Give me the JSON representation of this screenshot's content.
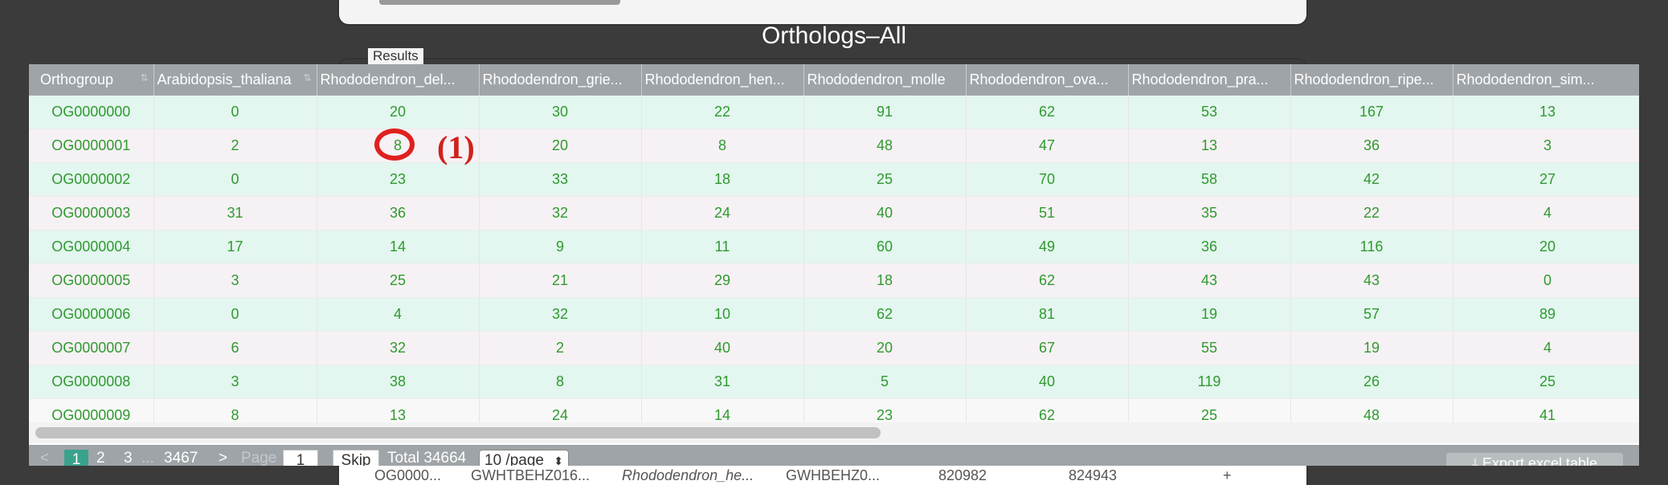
{
  "title": "Orthologs–All",
  "results_legend": "Results",
  "table": {
    "columns": [
      "Orthogroup",
      "Arabidopsis_thaliana",
      "Rhododendron_del...",
      "Rhododendron_grie...",
      "Rhododendron_hen...",
      "Rhododendron_molle",
      "Rhododendron_ova...",
      "Rhododendron_pra...",
      "Rhododendron_ripe...",
      "Rhododendron_sim..."
    ],
    "rows": [
      [
        "OG0000000",
        "0",
        "20",
        "30",
        "22",
        "91",
        "62",
        "53",
        "167",
        "13"
      ],
      [
        "OG0000001",
        "2",
        "8",
        "20",
        "8",
        "48",
        "47",
        "13",
        "36",
        "3"
      ],
      [
        "OG0000002",
        "0",
        "23",
        "33",
        "18",
        "25",
        "70",
        "58",
        "42",
        "27"
      ],
      [
        "OG0000003",
        "31",
        "36",
        "32",
        "24",
        "40",
        "51",
        "35",
        "22",
        "4"
      ],
      [
        "OG0000004",
        "17",
        "14",
        "9",
        "11",
        "60",
        "49",
        "36",
        "116",
        "20"
      ],
      [
        "OG0000005",
        "3",
        "25",
        "21",
        "29",
        "18",
        "62",
        "43",
        "43",
        "0"
      ],
      [
        "OG0000006",
        "0",
        "4",
        "32",
        "10",
        "62",
        "81",
        "19",
        "57",
        "89"
      ],
      [
        "OG0000007",
        "6",
        "32",
        "2",
        "40",
        "20",
        "67",
        "55",
        "19",
        "4"
      ],
      [
        "OG0000008",
        "3",
        "38",
        "8",
        "31",
        "5",
        "40",
        "119",
        "26",
        "25"
      ],
      [
        "OG0000009",
        "8",
        "13",
        "24",
        "14",
        "23",
        "62",
        "25",
        "48",
        "41"
      ]
    ]
  },
  "pagination": {
    "prev": "<",
    "pages": [
      "1",
      "2",
      "3"
    ],
    "ellipsis": "...",
    "last_page": "3467",
    "next": ">",
    "page_label": "Page",
    "page_input": "1",
    "skip_label": "Skip",
    "total": "Total 34664",
    "page_size": "10 /page",
    "export_label": "Export excel table"
  },
  "underlying_row": {
    "orthogroup": "OG0000...",
    "gene": "GWHTBEHZ016...",
    "species": "Rhododendron_he...",
    "gene2": "GWHBEHZ0...",
    "start": "820982",
    "end": "824943",
    "action": "+"
  },
  "annotation": {
    "label": "(1)"
  },
  "colors": {
    "header_bg": "#9fa4a8",
    "cell_text": "#2f9a2f",
    "row_even": "#e3f6ef",
    "row_odd": "#f6f1f4",
    "active_page": "#3aa28c",
    "annotation": "#e0201e"
  }
}
